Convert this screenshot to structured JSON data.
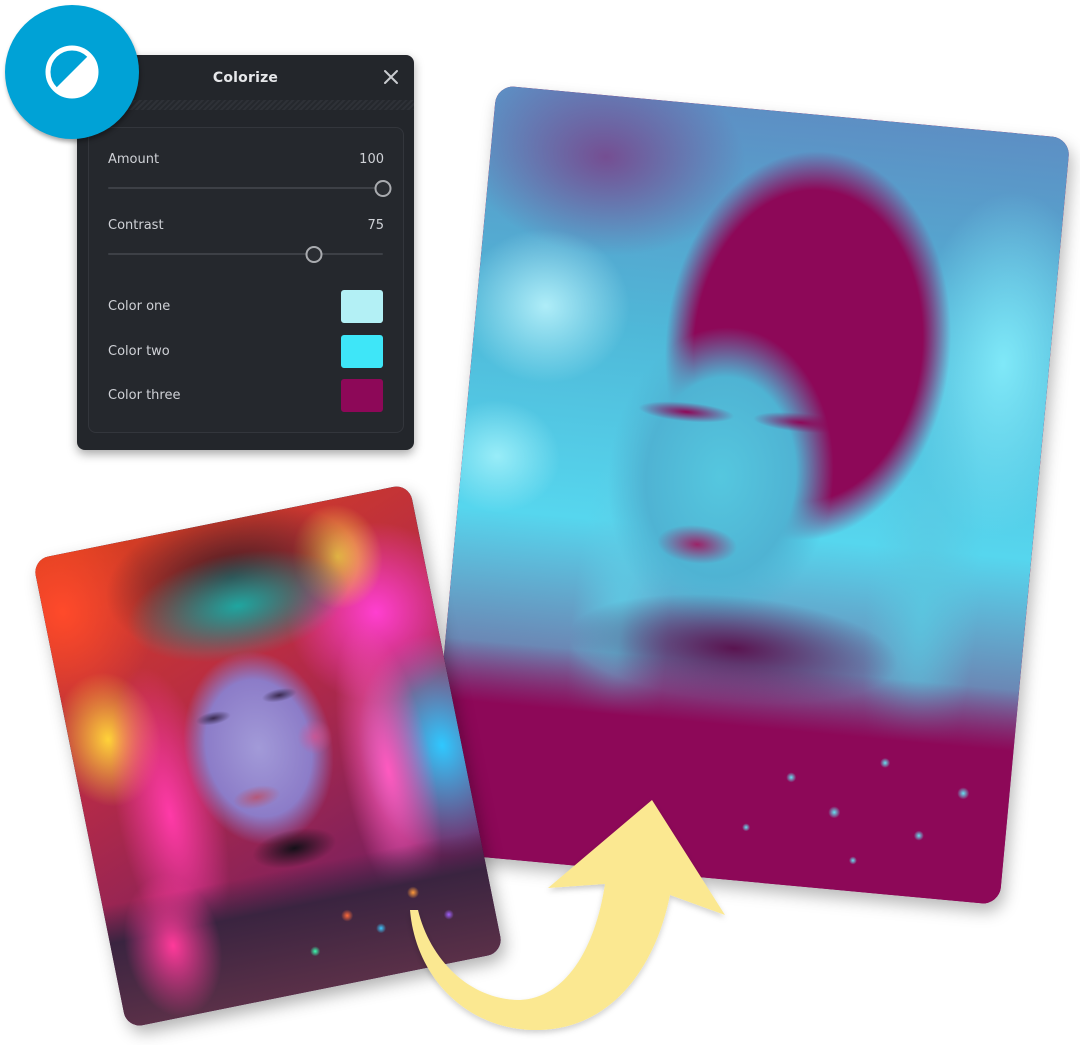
{
  "badge": {
    "icon": "contrast-half-circle-icon",
    "color": "#00a2d6"
  },
  "panel": {
    "title": "Colorize",
    "close_icon": "close-icon",
    "sliders": [
      {
        "label": "Amount",
        "value": "100",
        "fraction": 1.0
      },
      {
        "label": "Contrast",
        "value": "75",
        "fraction": 0.75
      }
    ],
    "colors": [
      {
        "label": "Color one",
        "hex": "#b3f0f5"
      },
      {
        "label": "Color two",
        "hex": "#3ee6f8"
      },
      {
        "label": "Color three",
        "hex": "#8d0858"
      }
    ]
  },
  "images": {
    "original": "original-neon-portrait-image",
    "result": "colorized-duotone-portrait-image"
  },
  "arrow": {
    "icon": "curved-arrow-icon",
    "color": "#fbe891"
  }
}
